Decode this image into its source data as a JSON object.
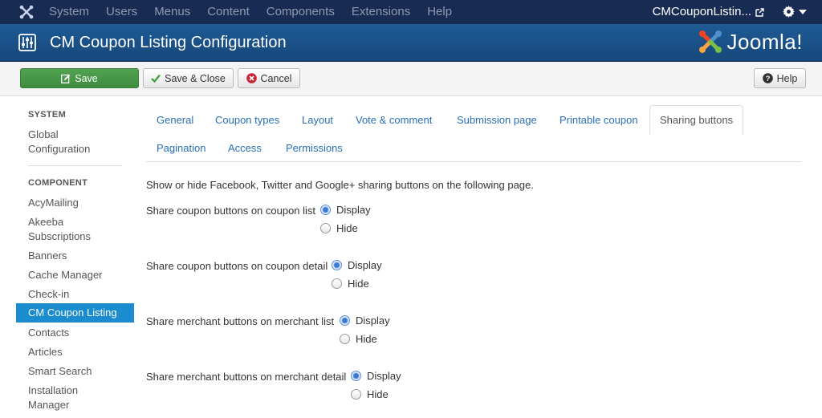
{
  "navbar": {
    "menu": [
      "System",
      "Users",
      "Menus",
      "Content",
      "Components",
      "Extensions",
      "Help"
    ],
    "site_name": "CMCouponListin...",
    "icons": [
      "joomla-icon",
      "external-link-icon",
      "gear-icon",
      "caret-down-icon"
    ]
  },
  "header": {
    "title": "CM Coupon Listing Configuration",
    "brand": "Joomla!"
  },
  "toolbar": {
    "save_label": "Save",
    "save_close_label": "Save & Close",
    "cancel_label": "Cancel",
    "help_label": "Help"
  },
  "sidebar": {
    "system_heading": "SYSTEM",
    "global_config": [
      "Global",
      "Configuration"
    ],
    "component_heading": "COMPONENT",
    "items": [
      {
        "label": "AcyMailing"
      },
      {
        "label": "Akeeba\nSubscriptions"
      },
      {
        "label": "Banners"
      },
      {
        "label": "Cache Manager"
      },
      {
        "label": "Check-in"
      },
      {
        "label": "CM Coupon Listing",
        "active": true
      },
      {
        "label": "Contacts"
      },
      {
        "label": "Articles"
      },
      {
        "label": "Smart Search"
      },
      {
        "label": "Installation\nManager"
      }
    ]
  },
  "tabs": {
    "row1": [
      "General",
      "Coupon types",
      "Layout",
      "Vote & comment",
      "Submission page",
      "Printable coupon",
      "Sharing buttons"
    ],
    "row2": [
      "Pagination",
      "Access",
      "Permissions"
    ],
    "active": "Sharing buttons"
  },
  "content": {
    "intro": "Show or hide Facebook, Twitter and Google+ sharing buttons on the following page.",
    "options": [
      {
        "label": "Share coupon buttons on coupon list",
        "display": "Display",
        "hide": "Hide",
        "selected": "Display"
      },
      {
        "label": "Share coupon buttons on coupon detail",
        "display": "Display",
        "hide": "Hide",
        "selected": "Display"
      },
      {
        "label": "Share merchant buttons on merchant list",
        "display": "Display",
        "hide": "Hide",
        "selected": "Display"
      },
      {
        "label": "Share merchant buttons on merchant detail",
        "display": "Display",
        "hide": "Hide",
        "selected": "Display"
      }
    ]
  },
  "colors": {
    "navbar_bg": "#182c53",
    "header_bg": "#1e5a95",
    "accent": "#1b8cd0",
    "save_button": "#46a046",
    "link": "#2a6fb6"
  }
}
